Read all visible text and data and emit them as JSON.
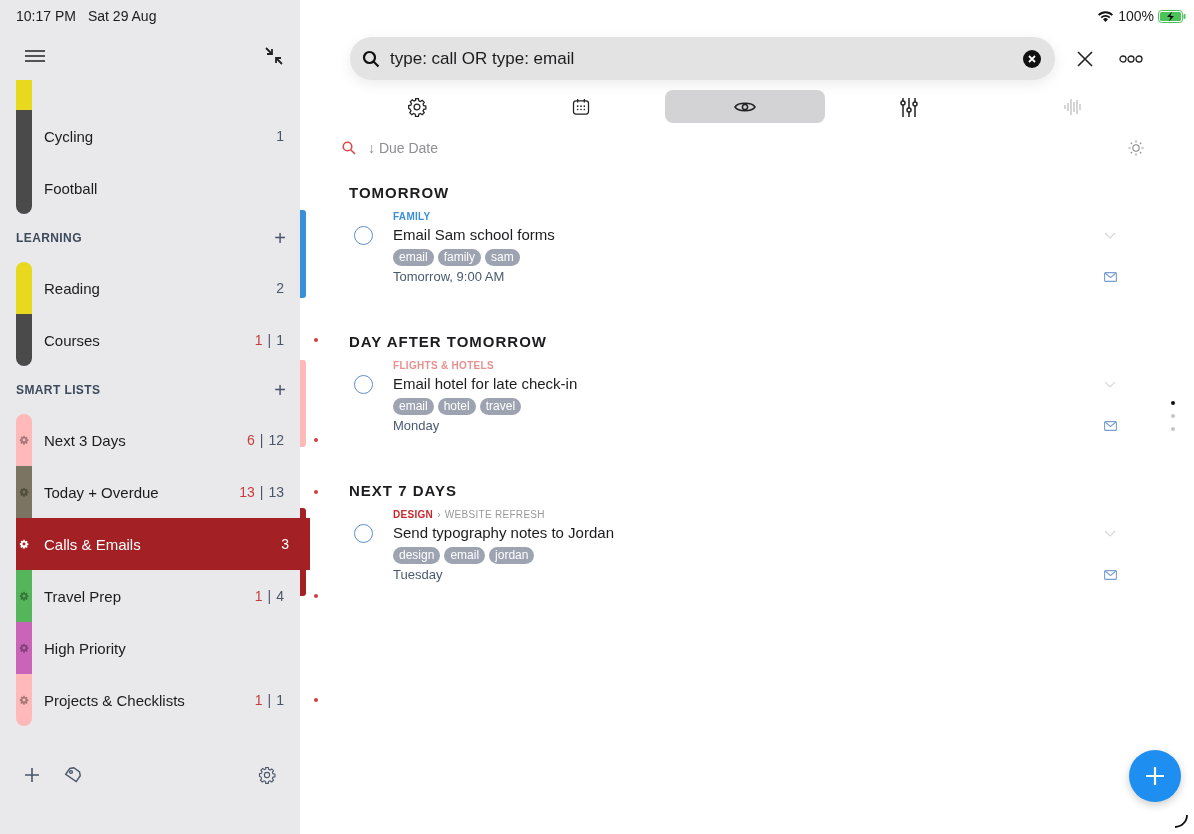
{
  "status_bar": {
    "time": "10:17 PM",
    "date": "Sat 29 Aug",
    "battery": "100%"
  },
  "sidebar": {
    "groups": [
      {
        "items": [
          {
            "kind": "stub",
            "color": "#e8d81e"
          },
          {
            "kind": "list",
            "name": "Cycling",
            "color": "#4a4a4a",
            "count": "1",
            "selected": false
          },
          {
            "kind": "list",
            "name": "Football",
            "color": "#4a4a4a",
            "selected": false
          }
        ]
      },
      {
        "title": "LEARNING",
        "add": "+",
        "items": [
          {
            "kind": "list",
            "name": "Reading",
            "color": "#e8d81e",
            "count": "2",
            "selected": false
          },
          {
            "kind": "list",
            "name": "Courses",
            "color": "#4a4a4a",
            "overdue": "1",
            "separator": "|",
            "count": "1",
            "selected": false
          }
        ]
      },
      {
        "title": "SMART LISTS",
        "add": "+",
        "items": [
          {
            "kind": "smart",
            "name": "Next 3 Days",
            "color": "#ffb9b9",
            "overdue": "6",
            "separator": "|",
            "count": "12",
            "selected": false
          },
          {
            "kind": "smart",
            "name": "Today + Overdue",
            "color": "#7a7460",
            "overdue": "13",
            "separator": "|",
            "count": "13",
            "selected": false
          },
          {
            "kind": "smart",
            "name": "Calls & Emails",
            "color": "#a32025",
            "count": "3",
            "selected": true
          },
          {
            "kind": "smart",
            "name": "Travel Prep",
            "color": "#55b55a",
            "overdue": "1",
            "separator": "|",
            "count": "4",
            "selected": false
          },
          {
            "kind": "smart",
            "name": "High Priority",
            "color": "#c964b8",
            "selected": false
          },
          {
            "kind": "smart",
            "name": "Projects & Checklists",
            "color": "#ffb9b9",
            "overdue": "1",
            "separator": "|",
            "count": "1",
            "selected": false
          }
        ]
      }
    ]
  },
  "search": {
    "value": "type: call OR type: email"
  },
  "tabs": [
    {
      "selected": false,
      "disabled": false
    },
    {
      "selected": false,
      "disabled": false
    },
    {
      "selected": true,
      "disabled": false
    },
    {
      "selected": false,
      "disabled": false
    },
    {
      "selected": false,
      "disabled": true
    }
  ],
  "sort": {
    "label": "Due Date",
    "arrow": "↓"
  },
  "sections": [
    {
      "title": "TOMORROW",
      "tasks": [
        {
          "category": {
            "project": "FAMILY",
            "color": "#3a8fd8"
          },
          "title": "Email Sam school forms",
          "tags": [
            "email",
            "family",
            "sam"
          ],
          "due": "Tomorrow, 9:00 AM",
          "checked": false
        }
      ]
    },
    {
      "title": "DAY AFTER TOMORROW",
      "tasks": [
        {
          "category": {
            "project": "FLIGHTS & HOTELS",
            "color": "#e89090"
          },
          "title": "Email hotel for late check-in",
          "tags": [
            "email",
            "hotel",
            "travel"
          ],
          "due": "Monday",
          "checked": false
        }
      ]
    },
    {
      "title": "NEXT 7 DAYS",
      "tasks": [
        {
          "category": {
            "project": "DESIGN",
            "color": "#c8282c",
            "separator": "›",
            "area": "WEBSITE REFRESH"
          },
          "title": "Send typography notes to Jordan",
          "tags": [
            "design",
            "email",
            "jordan"
          ],
          "due": "Tuesday",
          "checked": false
        }
      ]
    }
  ],
  "pager": [
    {
      "selected": true
    },
    {
      "selected": false
    },
    {
      "selected": false
    }
  ]
}
